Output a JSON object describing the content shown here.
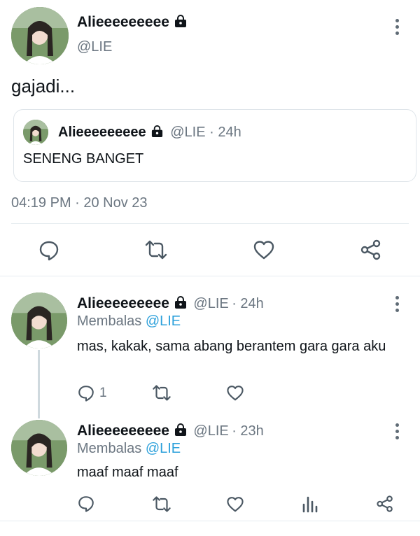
{
  "main_tweet": {
    "author_name": "Alieeeeeeeee",
    "author_handle": "@LIE",
    "text": "gajadi...",
    "timestamp": "04:19 PM · 20 Nov 23",
    "quoted": {
      "author_name": "Alieeeeeeeee",
      "author_handle": "@LIE",
      "age": "· 24h",
      "text": "SENENG BANGET"
    },
    "actions": [
      "reply-icon",
      "retweet-icon",
      "like-icon",
      "share-icon"
    ]
  },
  "replies": [
    {
      "author_name": "Alieeeeeeeee",
      "author_handle": "@LIE",
      "age": "· 24h",
      "replying_prefix": "Membalas",
      "replying_to": "@LIE",
      "text": "mas, kakak, sama abang berantem gara gara aku",
      "reply_count": "1"
    },
    {
      "author_name": "Alieeeeeeeee",
      "author_handle": "@LIE",
      "age": "· 23h",
      "replying_prefix": "Membalas",
      "replying_to": "@LIE",
      "text": "maaf maaf maaf"
    }
  ],
  "colors": {
    "text": "#0f1419",
    "muted": "#6b7681",
    "link": "#2ea1db",
    "divider": "#e6ecf0"
  }
}
